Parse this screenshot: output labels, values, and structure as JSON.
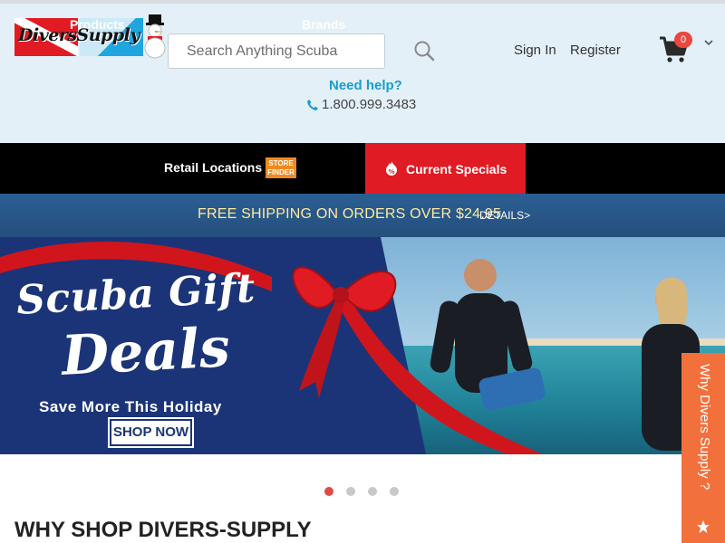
{
  "brand": {
    "logo_text": "DiversSupply"
  },
  "search": {
    "placeholder": "Search Anything Scuba"
  },
  "account": {
    "signin": "Sign In",
    "register": "Register"
  },
  "cart": {
    "count": "0"
  },
  "help": {
    "label": "Need help?",
    "phone": "1.800.999.3483"
  },
  "nav": {
    "products": "Products",
    "retail_locations": "Retail Locations",
    "store_finder": "STORE FINDER",
    "brands": "Brands",
    "current_specials": "Current Specials"
  },
  "shipping": {
    "text": "FREE SHIPPING ON ORDERS OVER $24.95",
    "details": "DETAILS>"
  },
  "hero": {
    "title_line1": "Scuba Gift",
    "title_line2": "Deals",
    "subtitle": "Save More This Holiday",
    "cta": "SHOP NOW",
    "slides_total": 4,
    "active_slide": 1
  },
  "section": {
    "why_heading": "WHY SHOP DIVERS-SUPPLY"
  },
  "side_tab": {
    "label": "Why Divers Supply ?"
  },
  "colors": {
    "accent_red": "#e01b24",
    "link_blue": "#1a9dd0",
    "ship_bar": "#2b5f93",
    "side_tab": "#f2703c"
  }
}
